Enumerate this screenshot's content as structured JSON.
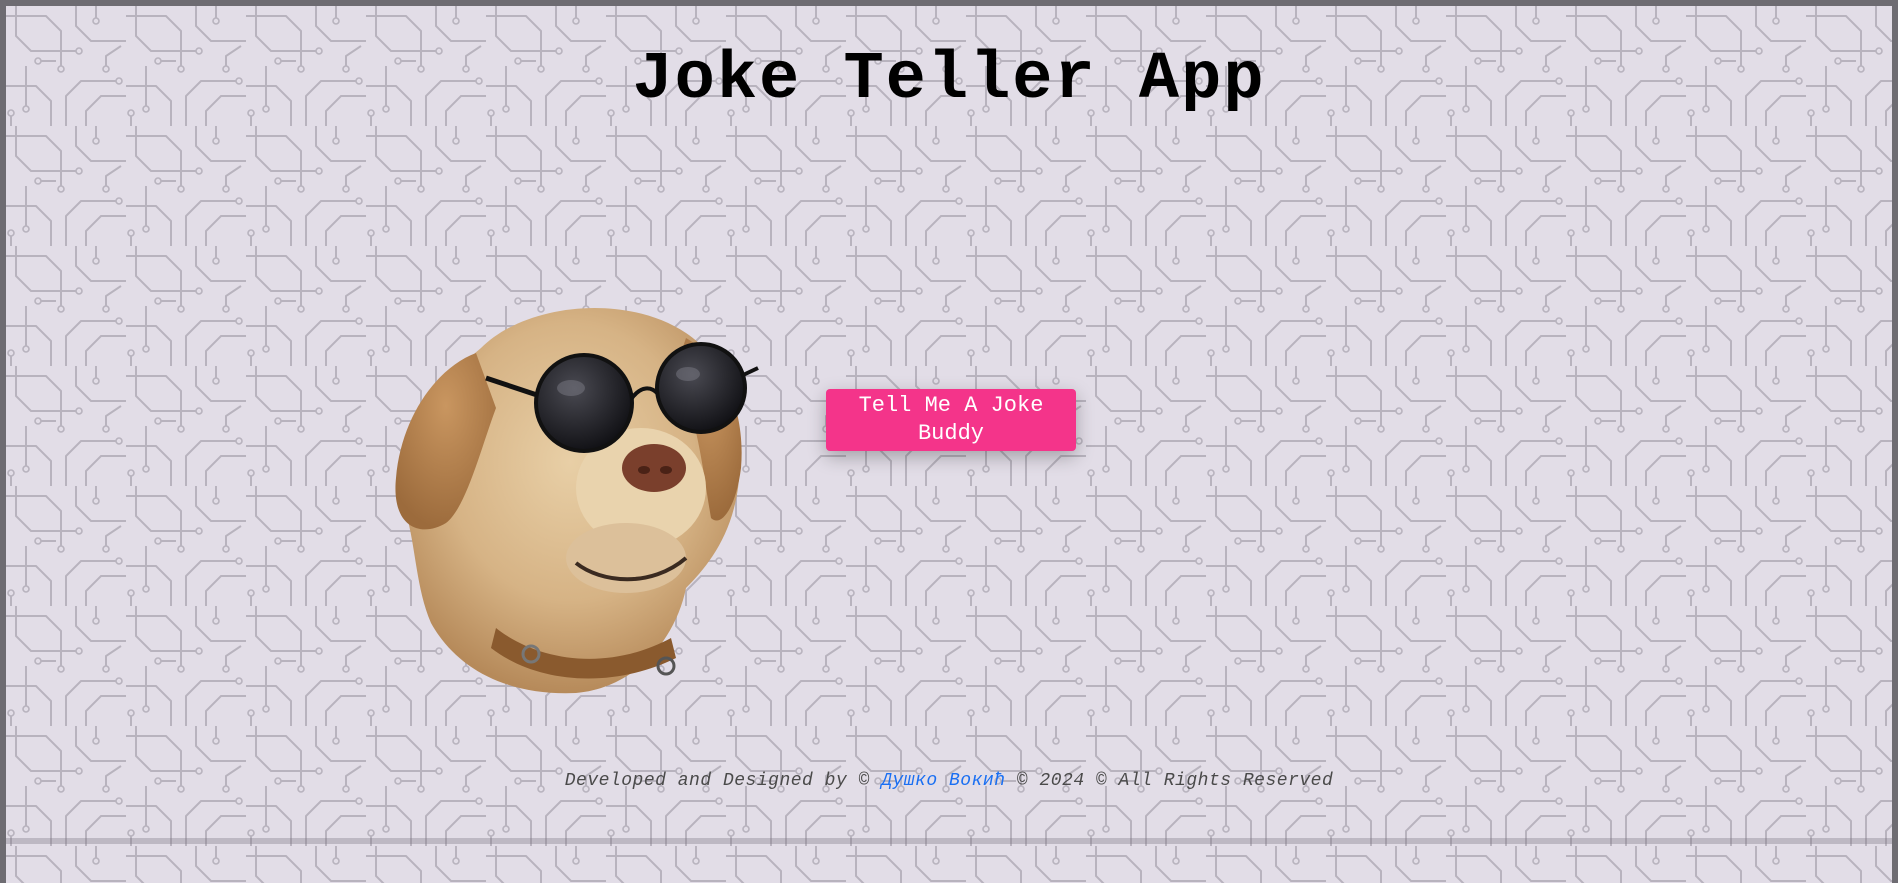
{
  "app": {
    "title": "Joke Teller App"
  },
  "main": {
    "button_label": "Tell Me A Joke Buddy",
    "mascot_icon": "dog-with-sunglasses-icon"
  },
  "footer": {
    "prefix": "Developed and Designed by ©",
    "author_link": "Душко Вокић",
    "suffix": "© 2024 © All Rights Reserved"
  },
  "colors": {
    "background": "#e2dde7",
    "circuit_lines": "#b8b3be",
    "button": "#f4348a",
    "link": "#1a6ff2"
  }
}
